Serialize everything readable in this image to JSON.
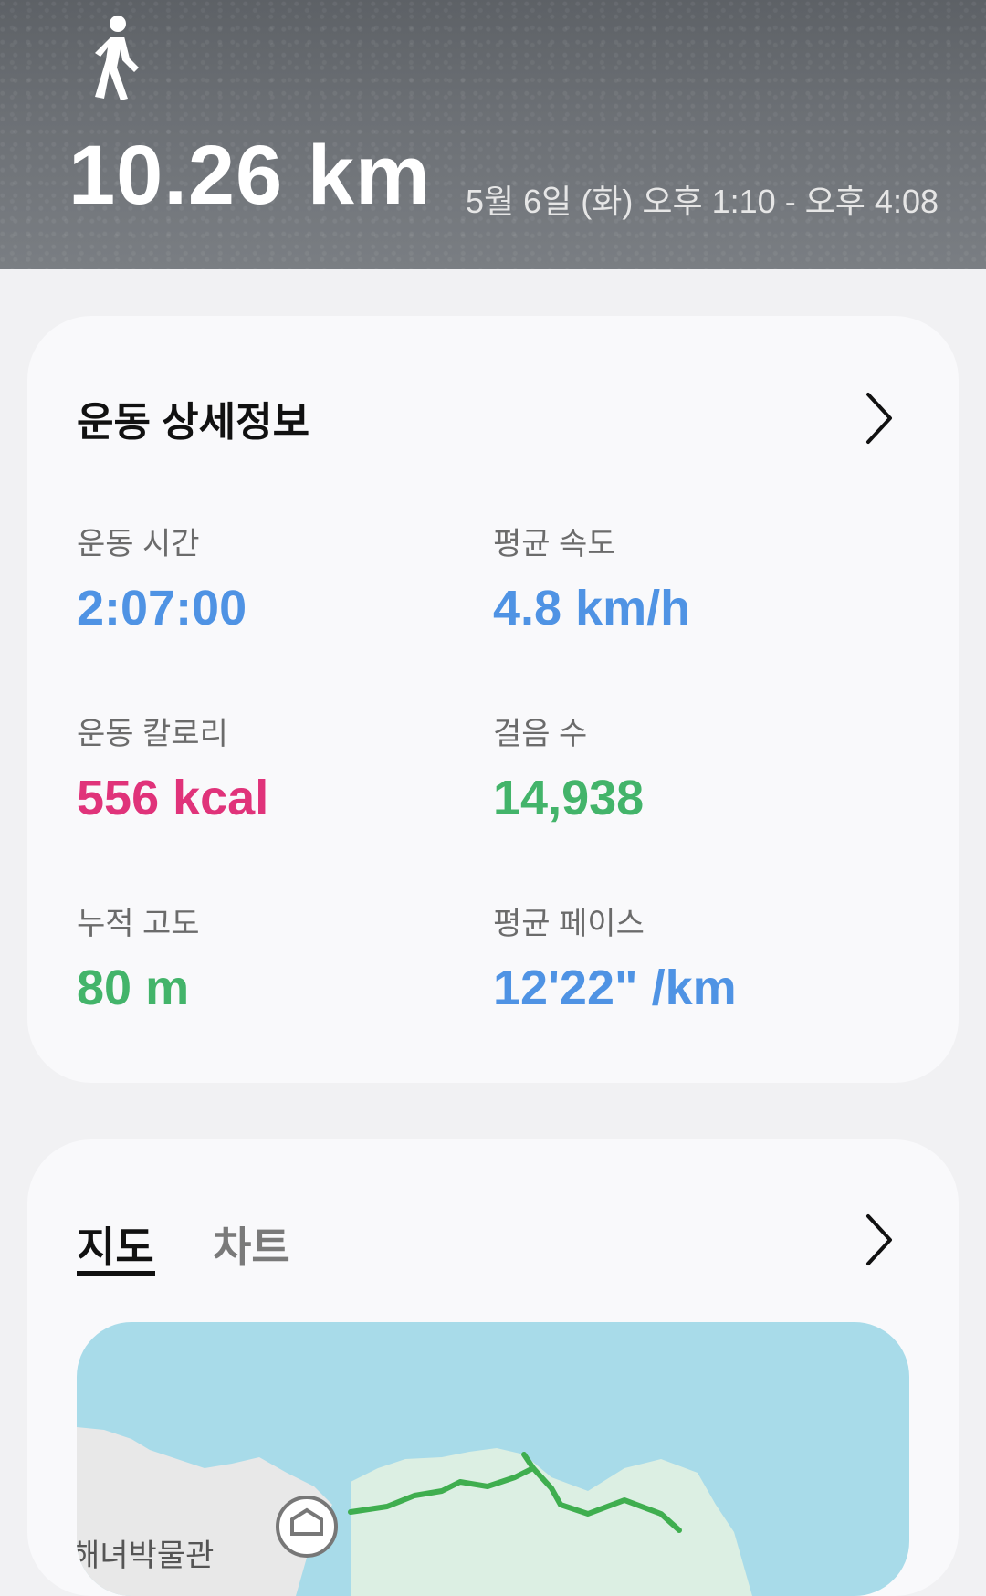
{
  "header": {
    "activity_icon": "walking-person-icon",
    "distance": "10.26 km",
    "date_range": "5월 6일 (화) 오후 1:10 - 오후 4:08"
  },
  "details_card": {
    "title": "운동 상세정보",
    "chevron_icon": "chevron-right-icon",
    "stats": [
      {
        "label": "운동 시간",
        "value": "2:07:00"
      },
      {
        "label": "평균 속도",
        "value": "4.8 km/h"
      },
      {
        "label": "운동 칼로리",
        "value": "556 kcal"
      },
      {
        "label": "걸음 수",
        "value": "14,938"
      },
      {
        "label": "누적 고도",
        "value": "80 m"
      },
      {
        "label": "평균 페이스",
        "value": "12'22\" /km"
      }
    ],
    "colors": {
      "blue": "#4f93e4",
      "pink": "#e0337a",
      "green": "#43b46a"
    }
  },
  "map_card": {
    "tabs": [
      {
        "label": "지도",
        "active": true
      },
      {
        "label": "차트",
        "active": false
      }
    ],
    "chevron_icon": "chevron-right-icon",
    "map_place_label": "해녀박물관",
    "map_place_icon": "museum-icon",
    "route_color": "#3fae4f"
  }
}
